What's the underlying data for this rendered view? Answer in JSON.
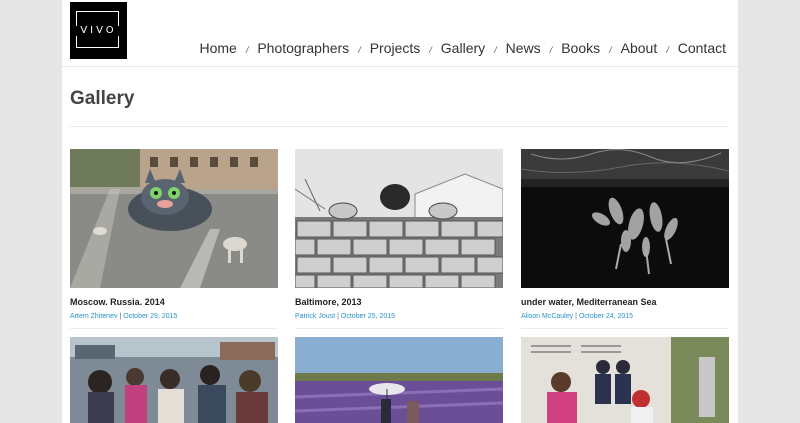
{
  "logo": {
    "text": "VIVO"
  },
  "nav": {
    "items": [
      {
        "label": "Home"
      },
      {
        "label": "Photographers"
      },
      {
        "label": "Projects"
      },
      {
        "label": "Gallery"
      },
      {
        "label": "News"
      },
      {
        "label": "Books"
      },
      {
        "label": "About"
      },
      {
        "label": "Contact"
      }
    ],
    "separator": "/"
  },
  "page": {
    "title": "Gallery"
  },
  "gallery": [
    {
      "title": "Moscow. Russia. 2014",
      "author": "Artem Zhitenev",
      "date": "October 29, 2015"
    },
    {
      "title": "Baltimore, 2013",
      "author": "Patrick Joust",
      "date": "October 25, 2015"
    },
    {
      "title": "under water, Mediterranean Sea",
      "author": "Alison McCauley",
      "date": "October 24, 2015"
    }
  ],
  "meta_separator": "|"
}
